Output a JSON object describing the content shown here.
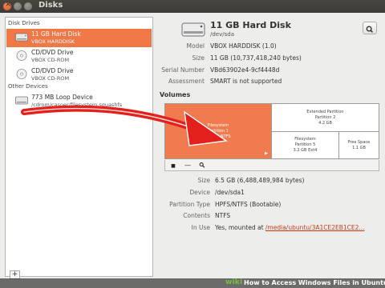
{
  "window": {
    "title": "Disks"
  },
  "sidebar": {
    "disk_drives_header": "Disk Drives",
    "other_devices_header": "Other Devices",
    "drives": [
      {
        "name": "11 GB Hard Disk",
        "sub": "VBOX HARDDISK",
        "icon": "hard-disk-icon",
        "selected": true
      },
      {
        "name": "CD/DVD Drive",
        "sub": "VBOX CD-ROM",
        "icon": "optical-drive-icon",
        "selected": false
      },
      {
        "name": "CD/DVD Drive",
        "sub": "VBOX CD-ROM",
        "icon": "optical-drive-icon",
        "selected": false
      }
    ],
    "other": [
      {
        "name": "773 MB Loop Device",
        "sub": "/cdrom/casper/filesystem.squashfs",
        "icon": "loop-device-icon"
      }
    ],
    "add_label": "+"
  },
  "disk": {
    "title": "11 GB Hard Disk",
    "path": "/dev/sda",
    "props": [
      {
        "label": "Model",
        "value": "VBOX HARDDISK (1.0)"
      },
      {
        "label": "Size",
        "value": "11 GB (10,737,418,240 bytes)"
      },
      {
        "label": "Serial Number",
        "value": "VBd63902e4-9cf4448d"
      },
      {
        "label": "Assessment",
        "value": "SMART is not supported"
      }
    ]
  },
  "volumes": {
    "header": "Volumes",
    "partitions": {
      "p1": {
        "line1": "Filesystem",
        "line2": "Partition 1",
        "line3": "6.5 GB NTFS"
      },
      "ext": {
        "line1": "Extended Partition",
        "line2": "Partition 2",
        "line3": "4.2 GB"
      },
      "p5": {
        "line1": "Filesystem",
        "line2": "Partition 5",
        "line3": "3.2 GB Ext4"
      },
      "free": {
        "line1": "Free Space",
        "line2": "1.1 GB"
      }
    },
    "toolbar": {
      "stop": "■",
      "minus": "—"
    }
  },
  "partition_details": [
    {
      "label": "Size",
      "value": "6.5 GB (6,488,489,984 bytes)"
    },
    {
      "label": "Device",
      "value": "/dev/sda1"
    },
    {
      "label": "Partition Type",
      "value": "HPFS/NTFS (Bootable)"
    },
    {
      "label": "Contents",
      "value": "NTFS"
    },
    {
      "label": "In Use",
      "value_prefix": "Yes, mounted at ",
      "value_link": "/media/ubuntu/3A1CE2EB1CE2..."
    }
  ],
  "watermark": {
    "logo_main": "wiki",
    "logo_accent": "How",
    "text": "to Access Windows Files in Ubuntu"
  },
  "colors": {
    "accent": "#f07746",
    "arrow": "#e3201b",
    "titlebar": "#3c3b37"
  }
}
